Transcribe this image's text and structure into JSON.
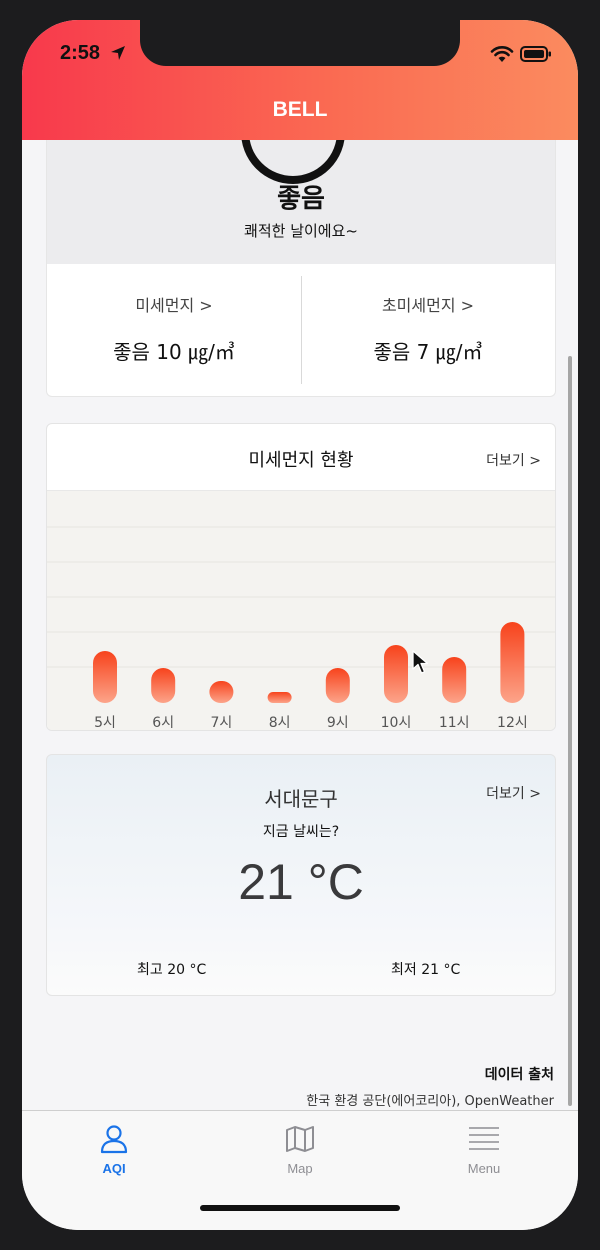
{
  "status_bar": {
    "time": "2:58"
  },
  "app": {
    "title": "BELL"
  },
  "aqi": {
    "grade": "좋음",
    "message": "쾌적한 날이에요~",
    "pm10": {
      "label": "미세먼지 >",
      "value": "좋음 10 ㎍/㎥"
    },
    "pm25": {
      "label": "초미세먼지 >",
      "value": "좋음 7 ㎍/㎥"
    }
  },
  "chart_card": {
    "title": "미세먼지 현황",
    "more": "더보기 >"
  },
  "chart_data": {
    "type": "bar",
    "categories": [
      "5시",
      "6시",
      "7시",
      "8시",
      "9시",
      "10시",
      "11시",
      "12시"
    ],
    "values": [
      52,
      35,
      22,
      11,
      35,
      58,
      46,
      81
    ],
    "ylim": [
      0,
      180
    ],
    "grid": true,
    "colors": {
      "top": "#f7431c",
      "bottom": "#fca48a"
    }
  },
  "weather": {
    "city": "서대문구",
    "more": "더보기 >",
    "now_label": "지금 날씨는?",
    "temp": "21 °C",
    "max": "최고 20 °C",
    "min": "최저 21 °C"
  },
  "source": {
    "title": "데이터 출처",
    "text": "한국 환경 공단(에어코리아), OpenWeather"
  },
  "tabs": [
    {
      "label": "AQI",
      "icon": "person-icon",
      "active": true
    },
    {
      "label": "Map",
      "icon": "map-icon",
      "active": false
    },
    {
      "label": "Menu",
      "icon": "menu-icon",
      "active": false
    }
  ],
  "colors": {
    "active_tab": "#1a73e8",
    "inactive_tab": "#8e8e93"
  }
}
